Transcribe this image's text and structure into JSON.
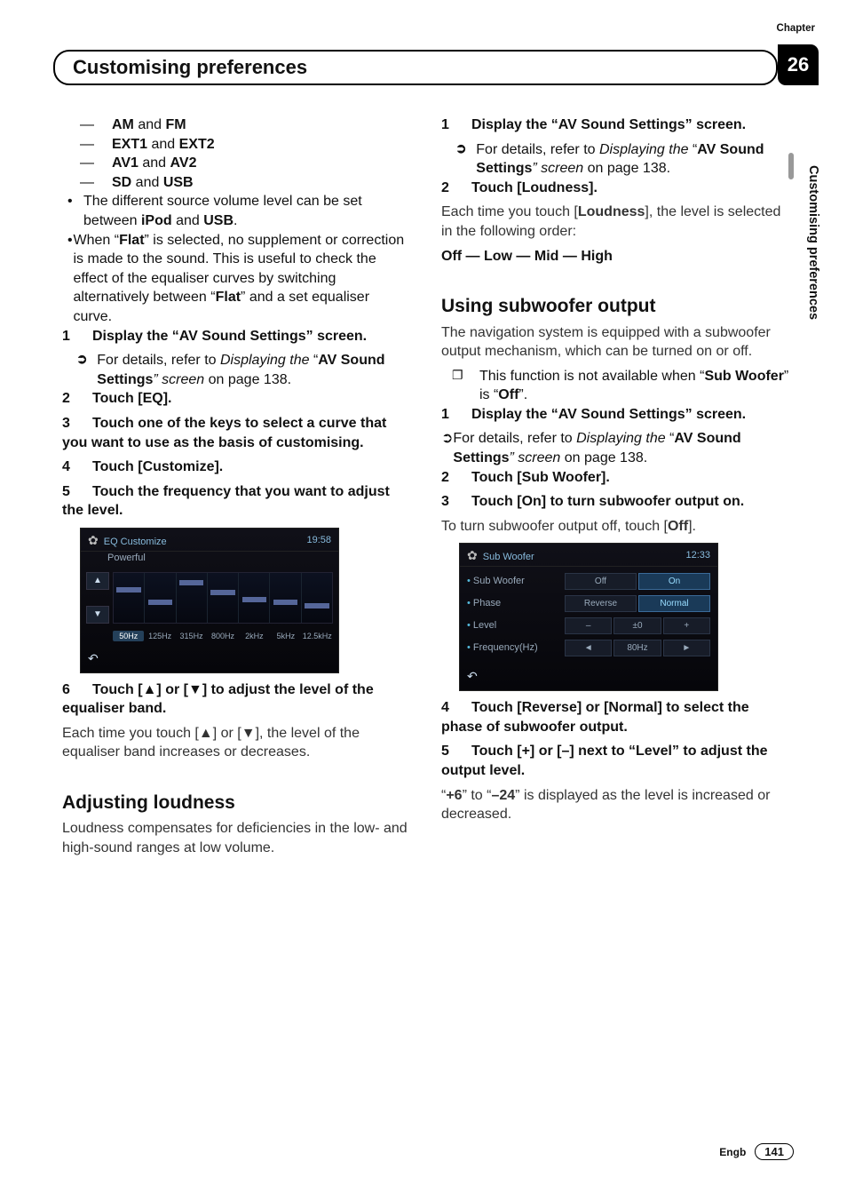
{
  "header": {
    "chapter_label": "Chapter",
    "chapter_number": "26",
    "title": "Customising preferences",
    "side_tab": "Customising preferences"
  },
  "left": {
    "pairs": [
      {
        "a": "AM",
        "mid": " and ",
        "b": "FM"
      },
      {
        "a": "EXT1",
        "mid": " and ",
        "b": "EXT2"
      },
      {
        "a": "AV1",
        "mid": " and ",
        "b": "AV2"
      },
      {
        "a": "SD",
        "mid": " and ",
        "b": "USB"
      }
    ],
    "bullet1_a": "The different source volume level can be set between ",
    "bullet1_b": "iPod",
    "bullet1_c": " and ",
    "bullet1_d": "USB",
    "bullet1_e": ".",
    "bullet2_a": "When “",
    "bullet2_b": "Flat",
    "bullet2_c": "” is selected, no supplement or correction is made to the sound. This is useful to check the effect of the equaliser curves by switching alternatively between “",
    "bullet2_d": "Flat",
    "bullet2_e": "” and a set equaliser curve.",
    "step1_num": "1",
    "step1": "Display the “AV Sound Settings” screen.",
    "step1_ref_a": "For details, refer to ",
    "step1_ref_b": "Displaying the ",
    "step1_ref_c": "“",
    "step1_ref_d": "AV Sound Settings",
    "step1_ref_e": "” screen",
    "step1_ref_f": " on page 138.",
    "step2_num": "2",
    "step2": "Touch [EQ].",
    "step3_num": "3",
    "step3": "Touch one of the keys to select a curve that you want to use as the basis of customising.",
    "step4_num": "4",
    "step4": "Touch [Customize].",
    "step5_num": "5",
    "step5": "Touch the frequency that you want to adjust the level.",
    "eq": {
      "title": "EQ Customize",
      "subtitle": "Powerful",
      "clock": "19:58",
      "labels": [
        "50Hz",
        "125Hz",
        "315Hz",
        "800Hz",
        "2kHz",
        "5kHz",
        "12.5kHz"
      ],
      "selected": 0
    },
    "step6_num": "6",
    "step6_a": "Touch [",
    "step6_b": "▲",
    "step6_c": "] or [",
    "step6_d": "▼",
    "step6_e": "] to adjust the level of the equaliser band.",
    "step6_body_a": "Each time you touch [",
    "step6_body_b": "▲",
    "step6_body_c": "] or [",
    "step6_body_d": "▼",
    "step6_body_e": "], the level of the equaliser band increases or decreases.",
    "sec2_title": "Adjusting loudness",
    "sec2_body": "Loudness compensates for deficiencies in the low- and high-sound ranges at low volume."
  },
  "right": {
    "step1_num": "1",
    "step1": "Display the “AV Sound Settings” screen.",
    "step1_ref_a": "For details, refer to ",
    "step1_ref_b": "Displaying the ",
    "step1_ref_c": "“",
    "step1_ref_d": "AV Sound Settings",
    "step1_ref_e": "” screen",
    "step1_ref_f": " on page 138.",
    "step2_num": "2",
    "step2": "Touch [Loudness].",
    "step2_body_a": "Each time you touch [",
    "step2_body_b": "Loudness",
    "step2_body_c": "], the level is selected in the following order:",
    "step2_seq": "Off — Low — Mid — High",
    "sec3_title": "Using subwoofer output",
    "sec3_body": "The navigation system is equipped with a subwoofer output mechanism, which can be turned on or off.",
    "sec3_note_a": "This function is not available when “",
    "sec3_note_b": "Sub Woofer",
    "sec3_note_c": "” is “",
    "sec3_note_d": "Off",
    "sec3_note_e": "”.",
    "s3_step1_num": "1",
    "s3_step1": "Display the “AV Sound Settings” screen.",
    "s3_step1_ref_a": "For details, refer to ",
    "s3_step1_ref_b": "Displaying the ",
    "s3_step1_ref_c": "“",
    "s3_step1_ref_d": "AV Sound Settings",
    "s3_step1_ref_e": "” screen",
    "s3_step1_ref_f": " on page 138.",
    "s3_step2_num": "2",
    "s3_step2": "Touch [Sub Woofer].",
    "s3_step3_num": "3",
    "s3_step3": "Touch [On] to turn subwoofer output on.",
    "s3_step3_body_a": "To turn subwoofer output off, touch [",
    "s3_step3_body_b": "Off",
    "s3_step3_body_c": "].",
    "sub": {
      "title": "Sub Woofer",
      "clock": "12:33",
      "rows": {
        "subwoofer": "Sub Woofer",
        "sub_off": "Off",
        "sub_on": "On",
        "phase": "Phase",
        "phase_rev": "Reverse",
        "phase_nor": "Normal",
        "level": "Level",
        "lvl_minus": "–",
        "lvl_val": "±0",
        "lvl_plus": "+",
        "freq": "Frequency(Hz)",
        "f_left": "◄",
        "f_val": "80Hz",
        "f_right": "►"
      }
    },
    "s3_step4_num": "4",
    "s3_step4": "Touch [Reverse] or [Normal] to select the phase of subwoofer output.",
    "s3_step5_num": "5",
    "s3_step5": "Touch [+] or [–] next to “Level” to adjust the output level.",
    "s3_step5_body_a": "“",
    "s3_step5_body_b": "+6",
    "s3_step5_body_c": "” to “",
    "s3_step5_body_d": "–24",
    "s3_step5_body_e": "” is displayed as the level is increased or decreased."
  },
  "footer": {
    "lang": "Engb",
    "page": "141"
  },
  "icons": {
    "back": "↶",
    "gear": "✿"
  }
}
